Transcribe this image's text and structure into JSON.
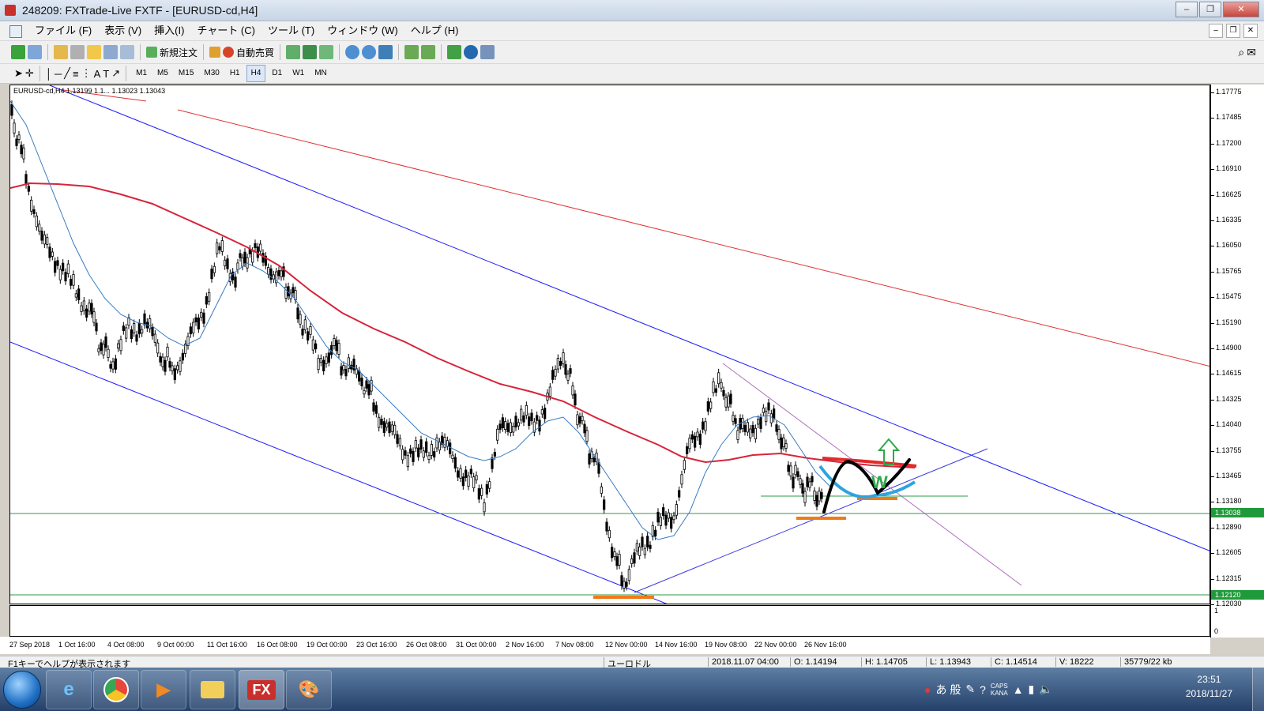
{
  "window": {
    "title": "248209: FXTrade-Live FXTF - [EURUSD-cd,H4]",
    "buttons": {
      "minimize": "–",
      "restore": "❐",
      "close": "✕"
    }
  },
  "menu": {
    "items": [
      "ファイル (F)",
      "表示 (V)",
      "挿入(I)",
      "チャート (C)",
      "ツール (T)",
      "ウィンドウ (W)",
      "ヘルプ (H)"
    ]
  },
  "toolbar": {
    "new_order": "新規注文",
    "auto_trade": "自動売買",
    "timeframes": [
      "M1",
      "M5",
      "M15",
      "M30",
      "H1",
      "H4",
      "D1",
      "W1",
      "MN"
    ],
    "active_timeframe": "H4"
  },
  "chart": {
    "header": "EURUSD-cd,H4  1.13199 1.1...  1.13023 1.13043",
    "price_ticks": [
      "1.17775",
      "1.17485",
      "1.17200",
      "1.16910",
      "1.16625",
      "1.16335",
      "1.16050",
      "1.15765",
      "1.15475",
      "1.15190",
      "1.14900",
      "1.14615",
      "1.14325",
      "1.14040",
      "1.13755",
      "1.13465",
      "1.13180",
      "1.12890",
      "1.12605",
      "1.12315",
      "1.12030"
    ],
    "price_highlights": [
      {
        "label": "1.13038",
        "color": "#1f9a3a"
      },
      {
        "label": "1.12120",
        "color": "#1f9a3a"
      }
    ],
    "time_ticks": [
      "27 Sep 2018",
      "1 Oct 16:00",
      "4 Oct 08:00",
      "9 Oct 00:00",
      "11 Oct 16:00",
      "16 Oct 08:00",
      "19 Oct 00:00",
      "23 Oct 16:00",
      "26 Oct 08:00",
      "31 Oct 00:00",
      "2 Nov 16:00",
      "7 Nov 08:00",
      "12 Nov 00:00",
      "14 Nov 16:00",
      "19 Nov 08:00",
      "22 Nov 00:00",
      "26 Nov 16:00"
    ],
    "sub_axis": [
      "1",
      "0"
    ],
    "annotation_letter": "W",
    "colors": {
      "channel": "#1a1aff",
      "resistance": "#e03030",
      "ma_long": "#d6243a",
      "ma_short": "#3a7bbf",
      "support": "#2f9a45",
      "marker": "#f07a1a",
      "w_pattern": "#000000",
      "w_curve": "#2ba4e0",
      "arrow": "#2ea84a"
    }
  },
  "status": {
    "help": "F1キーでヘルプが表示されます",
    "profile": "ユーロドル",
    "datetime": "2018.11.07 04:00",
    "open": "O: 1.14194",
    "high": "H: 1.14705",
    "low": "L: 1.13943",
    "close": "C: 1.14514",
    "volume": "V: 18222",
    "traffic": "35779/22 kb"
  },
  "taskbar": {
    "apps": [
      "ie-icon",
      "chrome-icon",
      "media-icon",
      "folder-icon",
      "fx-icon",
      "paint-icon"
    ],
    "fx_label": "FX",
    "ime": "あ 般",
    "caps": "CAPS",
    "kana": "KANA",
    "time": "23:51",
    "date": "2018/11/27"
  }
}
